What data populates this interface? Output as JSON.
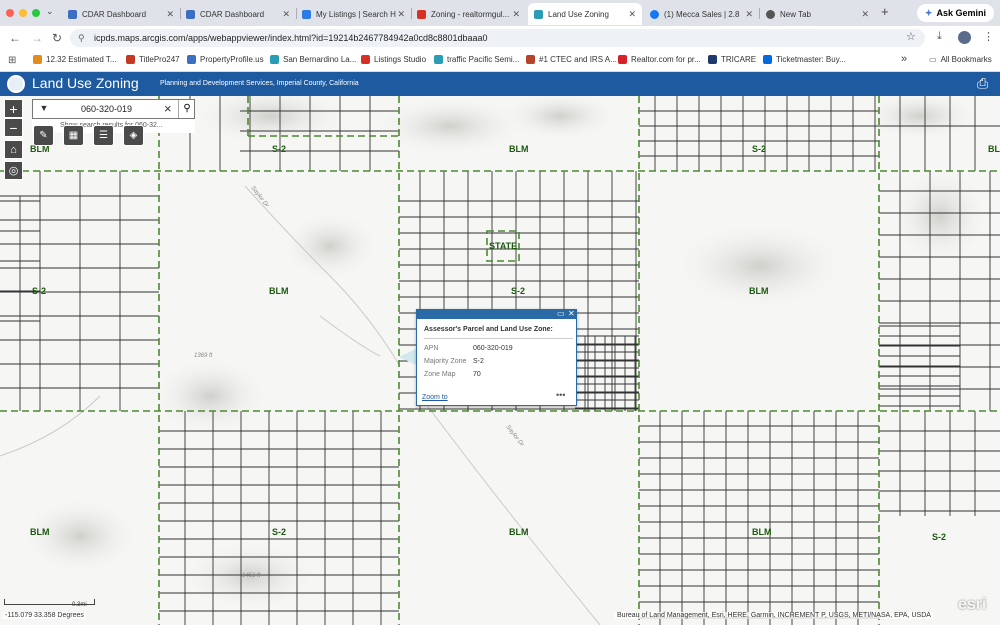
{
  "browser": {
    "tabs": [
      {
        "label": "CDAR Dashboard",
        "color": "#3b6fc4"
      },
      {
        "label": "CDAR Dashboard",
        "color": "#3b6fc4"
      },
      {
        "label": "My Listings | Search H",
        "color": "#2a7be4"
      },
      {
        "label": "Zoning - realtormgul...",
        "color": "#d93025"
      },
      {
        "label": "Land Use Zoning",
        "color": "#2a9db5"
      },
      {
        "label": "(1) Mecca Sales | 2.8",
        "color": "#1877f2"
      },
      {
        "label": "New Tab",
        "color": "#555555"
      }
    ],
    "active_tab": 4,
    "new_tab_symbol": "+",
    "gemini_label": "Ask Gemini",
    "url": "icpds.maps.arcgis.com/apps/webappviewer/index.html?id=19214b2467784942a0cd8c8801dbaaa0",
    "bookmarks": [
      {
        "label": "12.32 Estimated T...",
        "color": "#e38b1a"
      },
      {
        "label": "TitlePro247",
        "color": "#c23b22"
      },
      {
        "label": "PropertyProfile.us",
        "color": "#3b6fc4"
      },
      {
        "label": "San Bernardino La...",
        "color": "#2a9db5"
      },
      {
        "label": "Listings Studio",
        "color": "#d93025"
      },
      {
        "label": "traffic Pacific Semi...",
        "color": "#2a9db5"
      },
      {
        "label": "#1 CTEC and IRS A...",
        "color": "#b5442a"
      },
      {
        "label": "Realtor.com for pr...",
        "color": "#d92228"
      },
      {
        "label": "TRICARE",
        "color": "#1d3a6b"
      },
      {
        "label": "Ticketmaster: Buy...",
        "color": "#026cdf"
      }
    ],
    "bookmarks_overflow": "»",
    "all_bookmarks_label": "All Bookmarks"
  },
  "app": {
    "title": "Land Use Zoning",
    "subtitle": "Planning and Development Services, Imperial County, California",
    "header_color": "#1e5aa0"
  },
  "search": {
    "value": "060-320-019",
    "suggestion": "Show search results for 060-32..."
  },
  "map": {
    "zone_labels": [
      "BLM",
      "S-2",
      "BLM",
      "S-2",
      "BLM",
      "S-2",
      "BLM",
      "S-2",
      "BLM",
      "STATE",
      "BLM",
      "S-2",
      "BLM",
      "S-2",
      "BLM"
    ],
    "terrain_labels": [
      "Saylor Dr",
      "1369 ft",
      "Saylor Dr",
      "1451 ft"
    ],
    "zone_color": "#1c5a10",
    "parcel_line_color": "#333333",
    "zone_boundary_color": "#4a8a2e"
  },
  "popup": {
    "title": "Assessor's Parcel and Land Use Zone:",
    "fields": [
      {
        "label": "APN",
        "value": "060-320-019"
      },
      {
        "label": "Majority Zone",
        "value": "S-2"
      },
      {
        "label": "Zone Map",
        "value": "70"
      }
    ],
    "zoom_link": "Zoom to",
    "more": "•••"
  },
  "footer": {
    "scale_label": "0.3mi",
    "coordinates": "-115.079 33.358 Degrees",
    "attribution": "Bureau of Land Management, Esri, HERE, Garmin, INCREMENT P, USGS, METI/NASA, EPA, USDA",
    "esri_logo": "esri"
  }
}
